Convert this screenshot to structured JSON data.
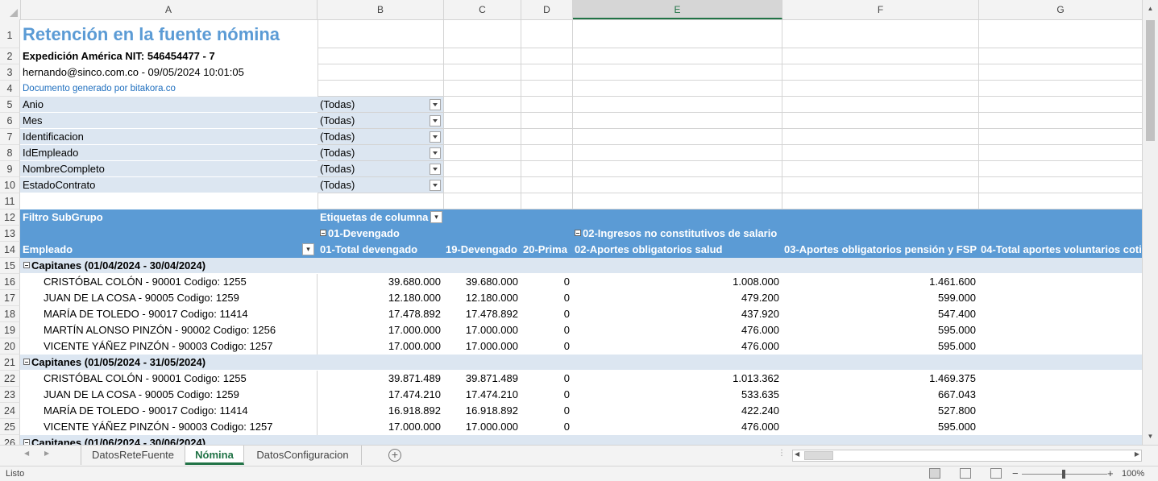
{
  "columns": [
    "A",
    "B",
    "C",
    "D",
    "E",
    "F",
    "G"
  ],
  "selected_column": "E",
  "rows": [
    "1",
    "2",
    "3",
    "4",
    "5",
    "6",
    "7",
    "8",
    "9",
    "10",
    "11",
    "12",
    "13",
    "14",
    "15",
    "16",
    "17",
    "18",
    "19",
    "20",
    "21",
    "22",
    "23",
    "24",
    "25",
    "26"
  ],
  "report": {
    "title": "Retención en la fuente nómina",
    "company": "Expedición América NIT: 546454477 - 7",
    "user_line": "hernando@sinco.com.co - 09/05/2024 10:01:05",
    "generated_by": "Documento generado por bitakora.co"
  },
  "filters": [
    {
      "name": "Anio",
      "value": "(Todas)"
    },
    {
      "name": "Mes",
      "value": "(Todas)"
    },
    {
      "name": "Identificacion",
      "value": "(Todas)"
    },
    {
      "name": "IdEmpleado",
      "value": "(Todas)"
    },
    {
      "name": "NombreCompleto",
      "value": "(Todas)"
    },
    {
      "name": "EstadoContrato",
      "value": "(Todas)"
    }
  ],
  "pivot": {
    "row_filter_label": "Filtro SubGrupo",
    "column_labels": "Etiquetas de columna",
    "group_1": "01-Devengado",
    "group_2": "02-Ingresos no constitutivos de salario",
    "row_field": "Empleado",
    "col_headers": [
      "01-Total devengado",
      "19-Devengado",
      "20-Prima",
      "02-Aportes obligatorios salud",
      "03-Aportes obligatorios pensión y FSP",
      "04-Total aportes voluntarios coti"
    ]
  },
  "table_rows": [
    {
      "type": "group",
      "label": "Capitanes (01/04/2024 - 30/04/2024)"
    },
    {
      "type": "data",
      "name": "CRISTÓBAL COLÓN - 90001 Codigo: 1255",
      "v": [
        "39.680.000",
        "39.680.000",
        "0",
        "1.008.000",
        "1.461.600",
        ""
      ]
    },
    {
      "type": "data",
      "name": "JUAN DE LA COSA - 90005 Codigo: 1259",
      "v": [
        "12.180.000",
        "12.180.000",
        "0",
        "479.200",
        "599.000",
        ""
      ]
    },
    {
      "type": "data",
      "name": "MARÍA DE TOLEDO - 90017 Codigo: 11414",
      "v": [
        "17.478.892",
        "17.478.892",
        "0",
        "437.920",
        "547.400",
        ""
      ]
    },
    {
      "type": "data",
      "name": "MARTÍN ALONSO PINZÓN - 90002 Codigo: 1256",
      "v": [
        "17.000.000",
        "17.000.000",
        "0",
        "476.000",
        "595.000",
        ""
      ]
    },
    {
      "type": "data",
      "name": "VICENTE YÁÑEZ PINZÓN - 90003 Codigo: 1257",
      "v": [
        "17.000.000",
        "17.000.000",
        "0",
        "476.000",
        "595.000",
        ""
      ]
    },
    {
      "type": "group",
      "label": "Capitanes (01/05/2024 - 31/05/2024)"
    },
    {
      "type": "data",
      "name": "CRISTÓBAL COLÓN - 90001 Codigo: 1255",
      "v": [
        "39.871.489",
        "39.871.489",
        "0",
        "1.013.362",
        "1.469.375",
        ""
      ]
    },
    {
      "type": "data",
      "name": "JUAN DE LA COSA - 90005 Codigo: 1259",
      "v": [
        "17.474.210",
        "17.474.210",
        "0",
        "533.635",
        "667.043",
        ""
      ]
    },
    {
      "type": "data",
      "name": "MARÍA DE TOLEDO - 90017 Codigo: 11414",
      "v": [
        "16.918.892",
        "16.918.892",
        "0",
        "422.240",
        "527.800",
        ""
      ]
    },
    {
      "type": "data",
      "name": "VICENTE YÁÑEZ PINZÓN - 90003 Codigo: 1257",
      "v": [
        "17.000.000",
        "17.000.000",
        "0",
        "476.000",
        "595.000",
        ""
      ]
    },
    {
      "type": "group",
      "label": "Capitanes (01/06/2024 - 30/06/2024)"
    }
  ],
  "sheet_tabs": [
    {
      "label": "DatosReteFuente",
      "active": false
    },
    {
      "label": "Nómina",
      "active": true
    },
    {
      "label": "DatosConfiguracion",
      "active": false
    }
  ],
  "status": {
    "ready": "Listo",
    "zoom": "100%"
  },
  "colors": {
    "accent": "#217346",
    "pivot_header": "#5b9bd5",
    "pivot_light": "#dce6f1",
    "title": "#5b9bd5",
    "link": "#1f6fbf"
  }
}
